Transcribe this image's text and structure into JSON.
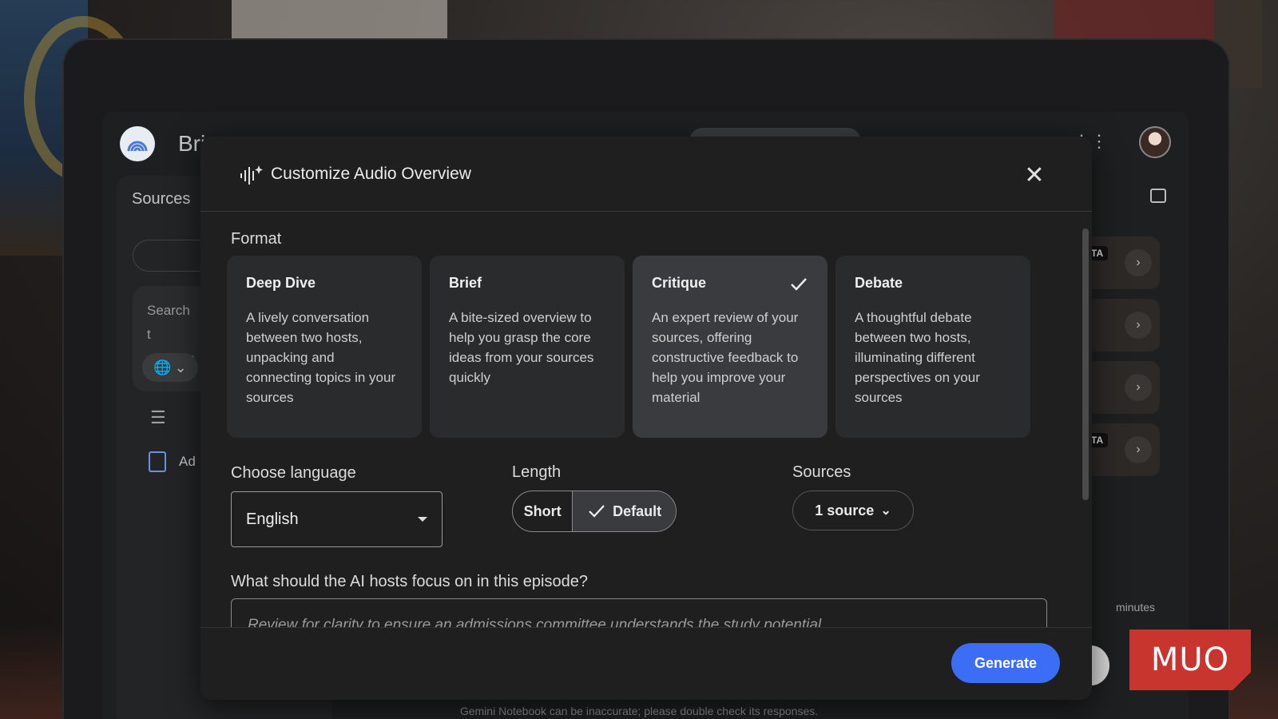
{
  "app": {
    "title": "Bri",
    "sources_heading": "Sources",
    "search_placeholder": "Search t sources",
    "doc_label": "Ad",
    "beta_label": "ETA",
    "minutes_label": "minutes",
    "footer_note": "Gemini Notebook can be inaccurate; please double check its responses."
  },
  "modal": {
    "title": "Customize Audio Overview",
    "close_icon": "close-icon",
    "format_label": "Format",
    "formats": [
      {
        "title": "Deep Dive",
        "description": "A lively conversation between two hosts, unpacking and connecting topics in your sources",
        "selected": false
      },
      {
        "title": "Brief",
        "description": "A bite-sized overview to help you grasp the core ideas from your sources quickly",
        "selected": false
      },
      {
        "title": "Critique",
        "description": "An expert review of your sources, offering constructive feedback to help you improve your material",
        "selected": true
      },
      {
        "title": "Debate",
        "description": "A thoughtful debate between two hosts, illuminating different perspectives on your sources",
        "selected": false
      }
    ],
    "language_label": "Choose language",
    "language_value": "English",
    "length_label": "Length",
    "length_options": [
      "Short",
      "Default"
    ],
    "length_selected": "Default",
    "sources_label": "Sources",
    "sources_value": "1 source",
    "focus_label": "What should the AI hosts focus on in this episode?",
    "focus_value": "Review for clarity to ensure an admissions committee understands the study potential",
    "generate_label": "Generate"
  },
  "watermark": "MUO",
  "colors": {
    "accent": "#3b6ef5",
    "modal_bg": "#1f1f1f",
    "card_bg": "#2a2b2d",
    "card_selected_bg": "#3a3b3e",
    "watermark_bg": "#c8352f"
  }
}
